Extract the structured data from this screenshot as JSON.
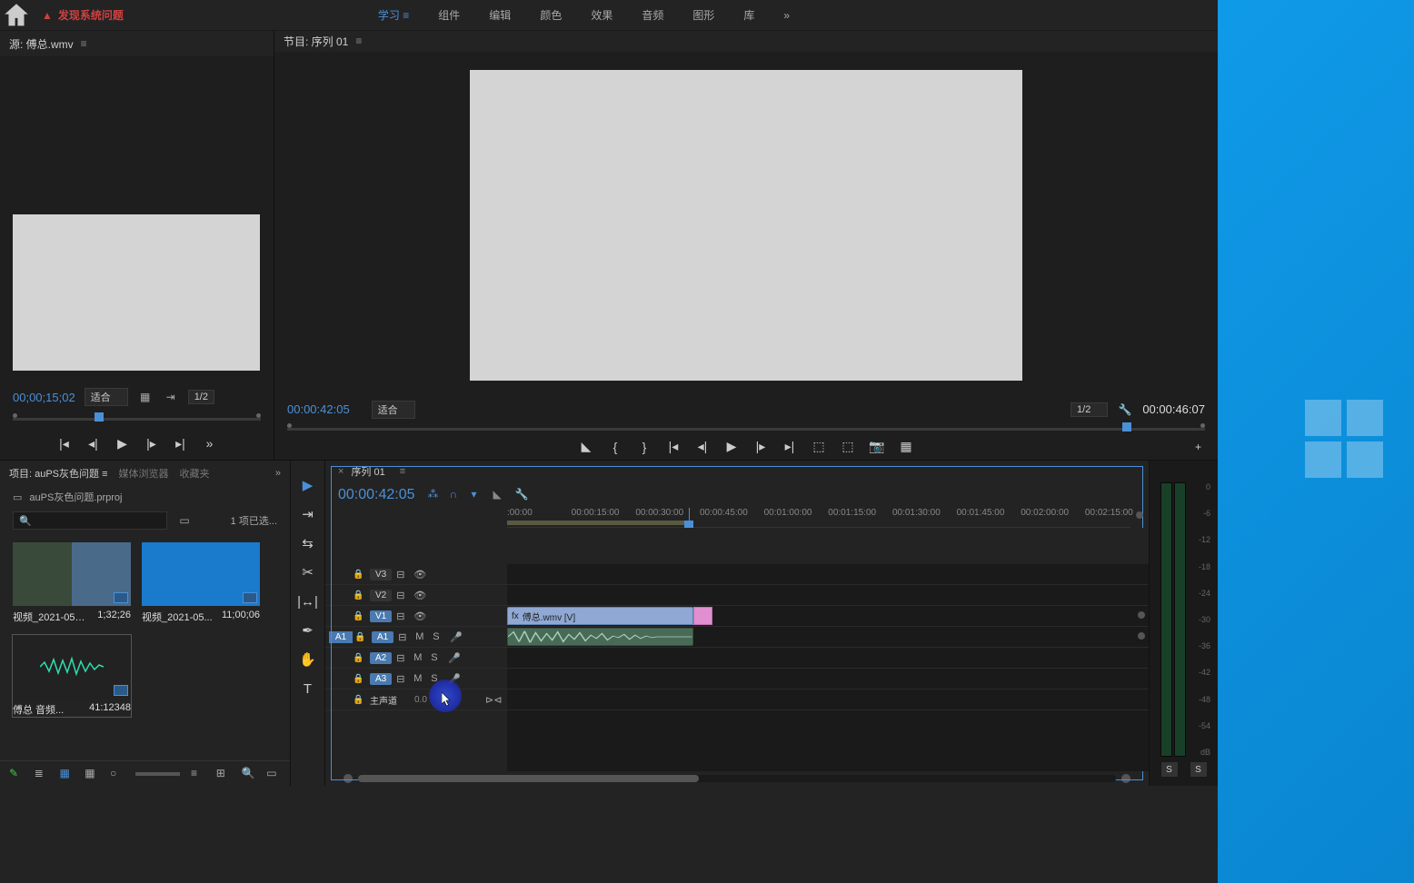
{
  "topbar": {
    "warning_text": "发现系统问题"
  },
  "workspaces": {
    "items": [
      "学习",
      "组件",
      "编辑",
      "颜色",
      "效果",
      "音频",
      "图形",
      "库"
    ],
    "active_index": 0
  },
  "source": {
    "title": "源: 傅总.wmv",
    "timecode": "00;00;15;02",
    "zoom": "适合",
    "resolution": "1/2"
  },
  "program": {
    "title": "节目: 序列 01",
    "timecode": "00:00:42:05",
    "zoom": "适合",
    "resolution": "1/2",
    "duration": "00:00:46:07"
  },
  "project": {
    "tab_project": "项目: auPS灰色问题",
    "tab_media": "媒体浏览器",
    "tab_favorites": "收藏夹",
    "path": "auPS灰色问题.prproj",
    "search_placeholder": "",
    "selection_status": "1 项已选...",
    "bins": [
      {
        "name": "视频_2021-05-2...",
        "duration": "1;32;26"
      },
      {
        "name": "视频_2021-05...",
        "duration": "11;00;06"
      },
      {
        "name": "傅总 音频...",
        "duration": "41:12348"
      }
    ]
  },
  "timeline": {
    "sequence_name": "序列 01",
    "timecode": "00:00:42:05",
    "ruler_ticks": [
      ":00:00",
      "00:00:15:00",
      "00:00:30:00",
      "00:00:45:00",
      "00:01:00:00",
      "00:01:15:00",
      "00:01:30:00",
      "00:01:45:00",
      "00:02:00:00",
      "00:02:15:00"
    ],
    "video_tracks": [
      {
        "name": "V3"
      },
      {
        "name": "V2"
      },
      {
        "name": "V1",
        "active": true
      }
    ],
    "audio_tracks": [
      {
        "name": "A1",
        "patched": "A1",
        "active": true
      },
      {
        "name": "A2"
      },
      {
        "name": "A3"
      }
    ],
    "master_track": "主声道",
    "master_value": "0.0",
    "clip_video": {
      "name": "傅总.wmv [V]",
      "start_pct": 0,
      "width_pct": 29
    },
    "clip_pink": {
      "start_pct": 29,
      "width_pct": 3
    },
    "clip_audio": {
      "start_pct": 0,
      "width_pct": 29
    },
    "playhead_pct": 29.2
  },
  "meters": {
    "scale": [
      "0",
      "-6",
      "-12",
      "-18",
      "-24",
      "-30",
      "-36",
      "-42",
      "-48",
      "-54",
      "dB"
    ],
    "labels": [
      "S",
      "S"
    ]
  }
}
